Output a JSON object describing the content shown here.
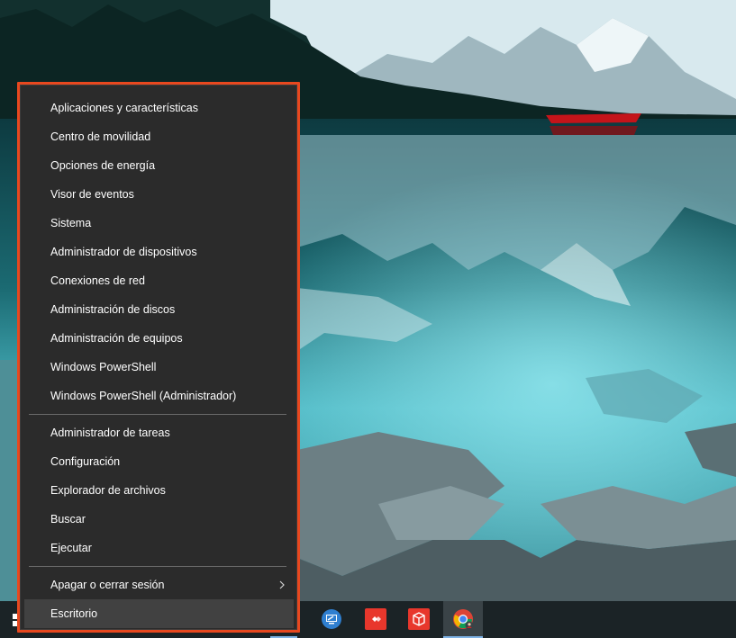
{
  "menu": {
    "groups": [
      {
        "items": [
          {
            "label": "Aplicaciones y características"
          },
          {
            "label": "Centro de movilidad"
          },
          {
            "label": "Opciones de energía"
          },
          {
            "label": "Visor de eventos"
          },
          {
            "label": "Sistema"
          },
          {
            "label": "Administrador de dispositivos"
          },
          {
            "label": "Conexiones de red"
          },
          {
            "label": "Administración de discos"
          },
          {
            "label": "Administración de equipos"
          },
          {
            "label": "Windows PowerShell"
          },
          {
            "label": "Windows PowerShell (Administrador)"
          }
        ]
      },
      {
        "items": [
          {
            "label": "Administrador de tareas"
          },
          {
            "label": "Configuración"
          },
          {
            "label": "Explorador de archivos"
          },
          {
            "label": "Buscar"
          },
          {
            "label": "Ejecutar"
          }
        ]
      },
      {
        "items": [
          {
            "label": "Apagar o cerrar sesión",
            "has_submenu": true
          },
          {
            "label": "Escritorio",
            "highlighted": true
          }
        ]
      }
    ],
    "highlight_border_color": "#e8481f"
  },
  "taskbar": {
    "start_icon": "windows-logo-icon",
    "apps": [
      {
        "icon": "remote-desktop-icon"
      },
      {
        "icon": "anydesk-icon"
      },
      {
        "icon": "3d-box-app-icon"
      },
      {
        "icon": "chrome-icon",
        "active": true
      }
    ]
  },
  "colors": {
    "menu_bg": "#2b2b2b",
    "menu_text": "#ffffff",
    "taskbar_bg": "#1b2326",
    "accent": "#7fb3e6"
  }
}
